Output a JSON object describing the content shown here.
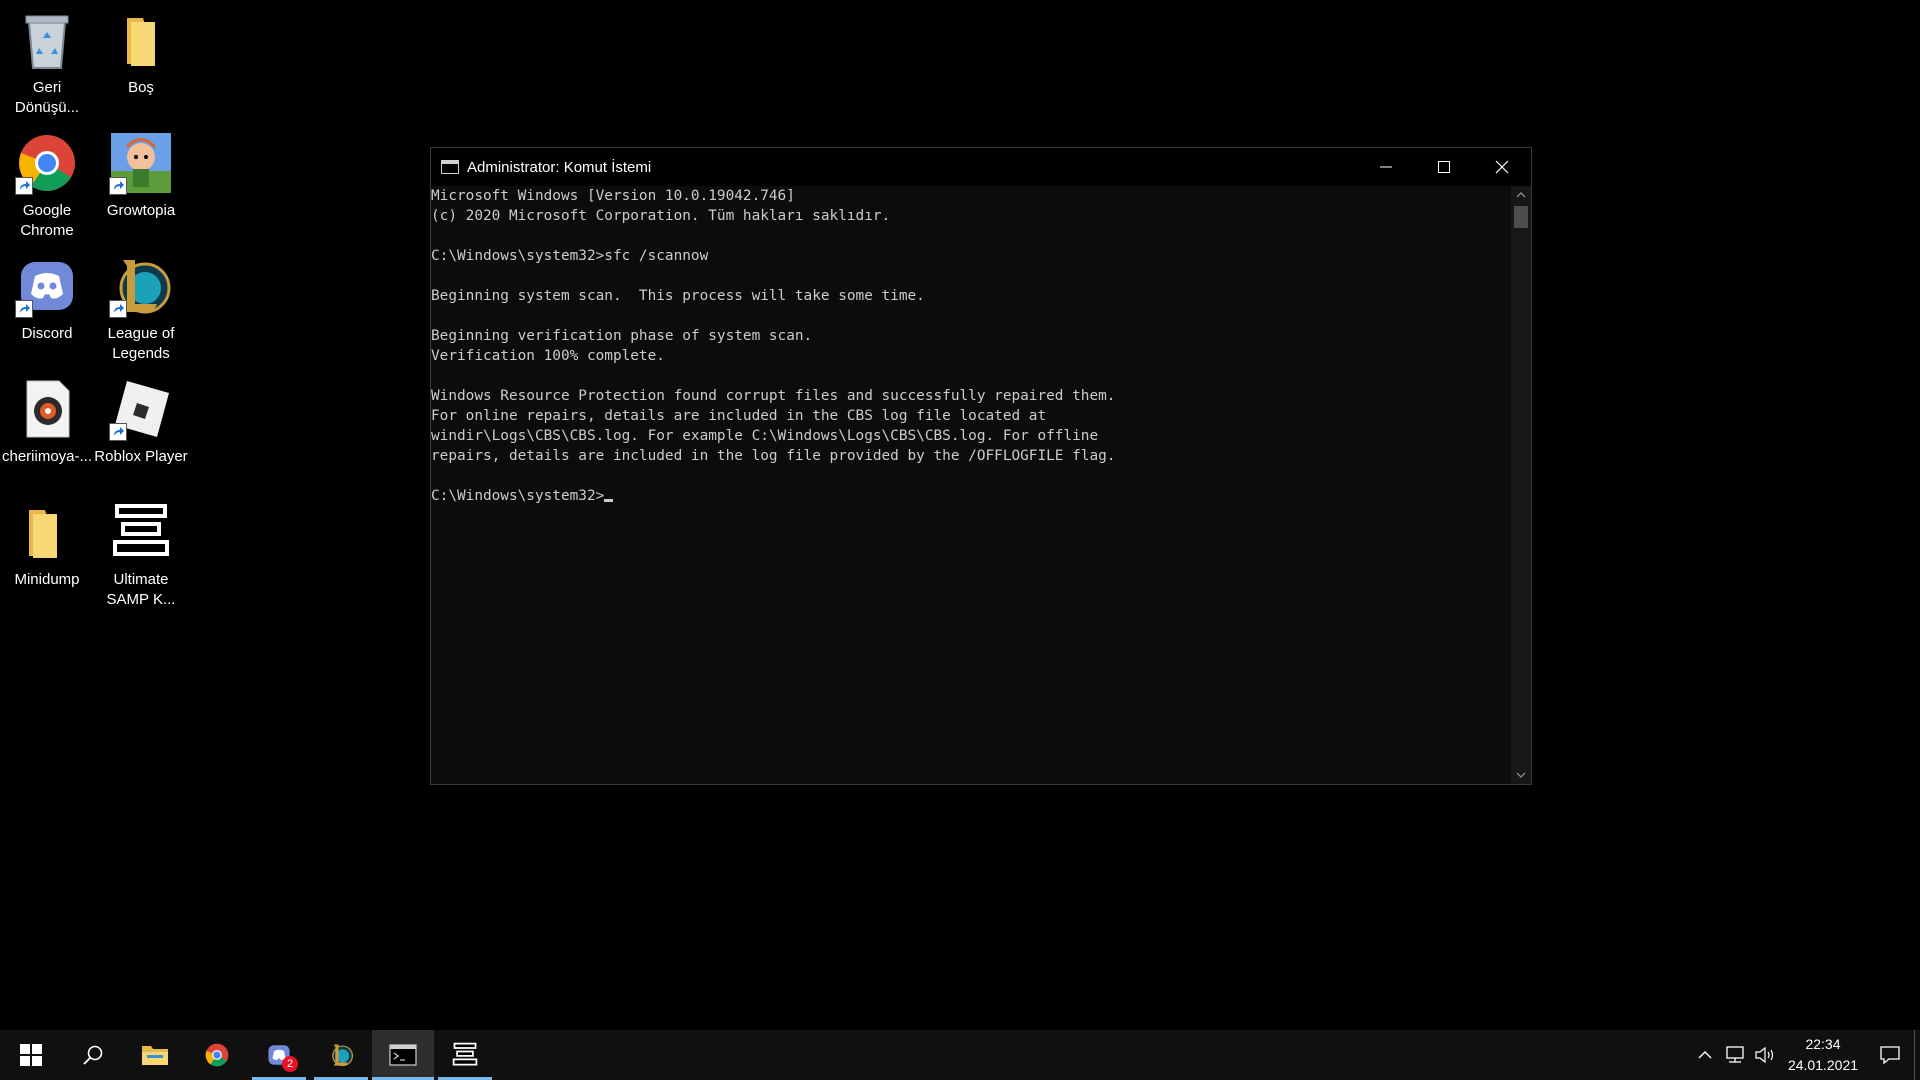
{
  "desktop": {
    "icons": [
      {
        "label": "Geri Dönüşü...",
        "icon": "recycle-bin-icon"
      },
      {
        "label": "Boş",
        "icon": "folder-icon"
      },
      {
        "label": "Google Chrome",
        "icon": "chrome-icon"
      },
      {
        "label": "Growtopia",
        "icon": "growtopia-icon"
      },
      {
        "label": "Discord",
        "icon": "discord-icon"
      },
      {
        "label": "League of Legends",
        "icon": "league-of-legends-icon"
      },
      {
        "label": "cheriimoya-...",
        "icon": "media-file-icon"
      },
      {
        "label": "Roblox Player",
        "icon": "roblox-icon"
      },
      {
        "label": "Minidump",
        "icon": "folder-icon"
      },
      {
        "label": "Ultimate SAMP K...",
        "icon": "samp-binder-icon"
      }
    ]
  },
  "console": {
    "title": "Administrator: Komut İstemi",
    "lines": [
      "Microsoft Windows [Version 10.0.19042.746]",
      "(c) 2020 Microsoft Corporation. Tüm hakları saklıdır.",
      "",
      "C:\\Windows\\system32>sfc /scannow",
      "",
      "Beginning system scan.  This process will take some time.",
      "",
      "Beginning verification phase of system scan.",
      "Verification 100% complete.",
      "",
      "Windows Resource Protection found corrupt files and successfully repaired them.",
      "For online repairs, details are included in the CBS log file located at",
      "windir\\Logs\\CBS\\CBS.log. For example C:\\Windows\\Logs\\CBS\\CBS.log. For offline",
      "repairs, details are included in the log file provided by the /OFFLOGFILE flag.",
      ""
    ],
    "prompt": "C:\\Windows\\system32>"
  },
  "taskbar": {
    "discord_badge": "2",
    "clock_time": "22:34",
    "clock_date": "24.01.2021"
  },
  "colors": {
    "accent": "#76b9ed",
    "console_text": "#cccccc",
    "console_bg": "#0c0c0c"
  }
}
